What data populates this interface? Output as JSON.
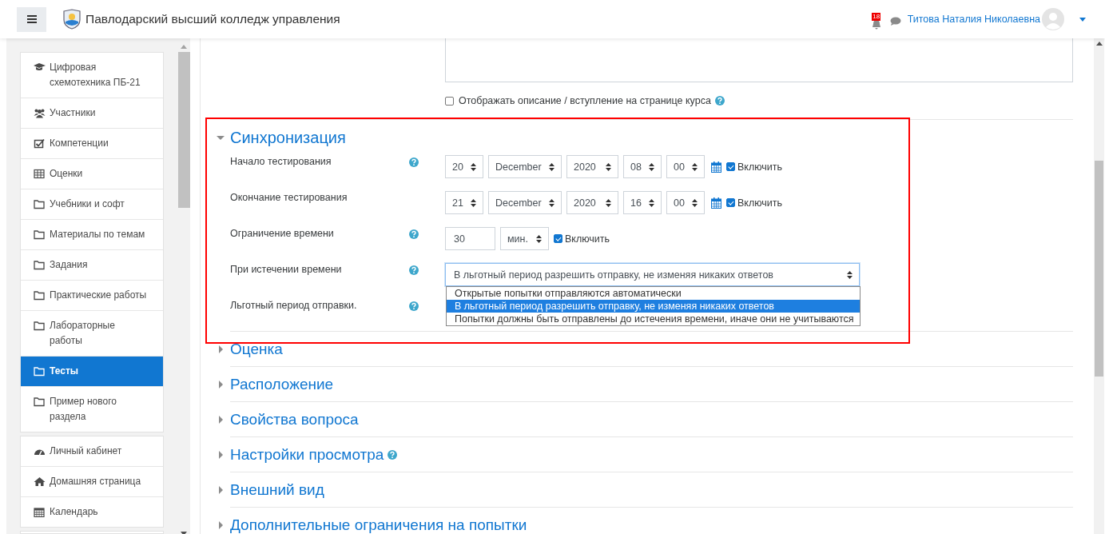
{
  "header": {
    "site_name": "Павлодарский высший колледж управления",
    "notification_count": "18",
    "user_name": "Титова Наталия Николаевна"
  },
  "sidebar": {
    "groups": [
      {
        "items": [
          {
            "kind": "course",
            "label": "Цифровая схемотехника ПБ-21",
            "selected": false
          },
          {
            "kind": "users",
            "label": "Участники",
            "selected": false
          },
          {
            "kind": "check",
            "label": "Компетенции",
            "selected": false
          },
          {
            "kind": "table",
            "label": "Оценки",
            "selected": false
          },
          {
            "kind": "folder",
            "label": "Учебники и софт",
            "selected": false
          },
          {
            "kind": "folder",
            "label": "Материалы по темам",
            "selected": false
          },
          {
            "kind": "folder",
            "label": "Задания",
            "selected": false
          },
          {
            "kind": "folder",
            "label": "Практические работы",
            "selected": false
          },
          {
            "kind": "folder",
            "label": "Лабораторные работы",
            "selected": false
          },
          {
            "kind": "folder",
            "label": "Тесты",
            "selected": true
          },
          {
            "kind": "folder",
            "label": "Пример нового раздела",
            "selected": false
          }
        ]
      },
      {
        "items": [
          {
            "kind": "dashboard",
            "label": "Личный кабинет",
            "selected": false
          },
          {
            "kind": "home",
            "label": "Домашняя страница",
            "selected": false
          },
          {
            "kind": "calendar",
            "label": "Календарь",
            "selected": false
          }
        ]
      }
    ]
  },
  "description_option": {
    "label": "Отображать описание / вступление на странице курса",
    "checked": false
  },
  "timing": {
    "title": "Синхронизация",
    "expanded": true,
    "fields": [
      {
        "kind": "datetime",
        "label": "Начало тестирования",
        "help": true,
        "parts": [
          "20",
          "December",
          "2020",
          "08",
          "00"
        ],
        "enable_label": "Включить",
        "enabled": true
      },
      {
        "kind": "datetime",
        "label": "Окончание тестирования",
        "help": false,
        "parts": [
          "21",
          "December",
          "2020",
          "16",
          "00"
        ],
        "enable_label": "Включить",
        "enabled": true
      },
      {
        "kind": "duration",
        "label": "Ограничение времени",
        "help": true,
        "value": "30",
        "unit": "мин.",
        "enable_label": "Включить",
        "enabled": true
      },
      {
        "kind": "select",
        "label": "При истечении времени",
        "help": true,
        "value": "В льготный период разрешить отправку, не изменяя никаких ответов",
        "options": [
          {
            "label": "Открытые попытки отправляются автоматически",
            "selected": false
          },
          {
            "label": "В льготный период разрешить отправку, не изменяя никаких ответов",
            "selected": true
          },
          {
            "label": "Попытки должны быть отправлены до истечения времени, иначе они не учитываются",
            "selected": false
          }
        ]
      },
      {
        "kind": "hidden",
        "label": "Льготный период отправки.",
        "help": true
      }
    ]
  },
  "sections": [
    {
      "title": "Оценка",
      "expanded": false,
      "help": false
    },
    {
      "title": "Расположение",
      "expanded": false,
      "help": false
    },
    {
      "title": "Свойства вопроса",
      "expanded": false,
      "help": false
    },
    {
      "title": "Настройки просмотра",
      "expanded": false,
      "help": true
    },
    {
      "title": "Внешний вид",
      "expanded": false,
      "help": false
    },
    {
      "title": "Дополнительные ограничения на попытки",
      "expanded": false,
      "help": false
    }
  ]
}
